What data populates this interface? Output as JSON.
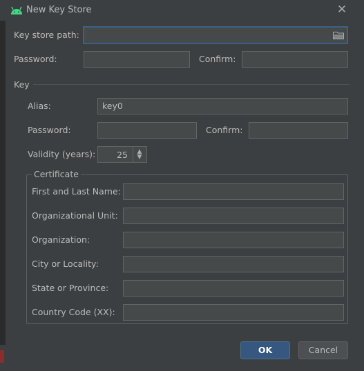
{
  "window": {
    "title": "New Key Store",
    "close_icon": "close-icon"
  },
  "keystore": {
    "path_label": "Key store path:",
    "path_value": "",
    "password_label": "Password:",
    "confirm_label": "Confirm:"
  },
  "key": {
    "section_label": "Key",
    "alias_label": "Alias:",
    "alias_value": "key0",
    "password_label": "Password:",
    "confirm_label": "Confirm:",
    "validity_label": "Validity (years):",
    "validity_value": "25"
  },
  "certificate": {
    "group_label": "Certificate",
    "first_last_name_label": "First and Last Name:",
    "org_unit_label": "Organizational Unit:",
    "organization_label": "Organization:",
    "city_label": "City or Locality:",
    "state_label": "State or Province:",
    "country_label": "Country Code (XX):"
  },
  "buttons": {
    "ok": "OK",
    "cancel": "Cancel"
  },
  "colors": {
    "accent": "#365880",
    "android_green": "#3ddc84",
    "focus_border": "#3d6185"
  }
}
